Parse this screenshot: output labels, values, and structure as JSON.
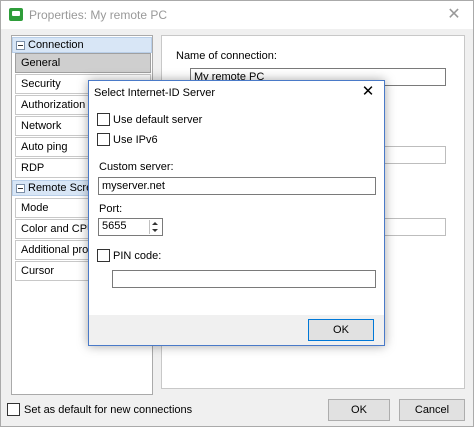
{
  "window": {
    "title": "Properties: My remote PC",
    "close_glyph": "✕"
  },
  "sidebar": {
    "groups": [
      {
        "label": "Connection",
        "items": [
          "General",
          "Security",
          "Authorization",
          "Network",
          "Auto ping",
          "RDP"
        ]
      },
      {
        "label": "Remote Screen",
        "items": [
          "Mode",
          "Color and CPU",
          "Additional prope",
          "Cursor"
        ]
      }
    ],
    "selected": "General"
  },
  "panel": {
    "name_label": "Name of connection:",
    "name_value": "My remote PC"
  },
  "footer": {
    "default_checkbox_label": "Set as default for new connections",
    "ok_label": "OK",
    "cancel_label": "Cancel"
  },
  "dialog": {
    "title": "Select Internet-ID Server",
    "close_glyph": "✕",
    "use_default_server_label": "Use default server",
    "use_ipv6_label": "Use IPv6",
    "custom_server_label": "Custom server:",
    "custom_server_value": "myserver.net",
    "port_label": "Port:",
    "port_value": "5655",
    "pin_label": "PIN code:",
    "pin_value": "",
    "ok_label": "OK"
  }
}
